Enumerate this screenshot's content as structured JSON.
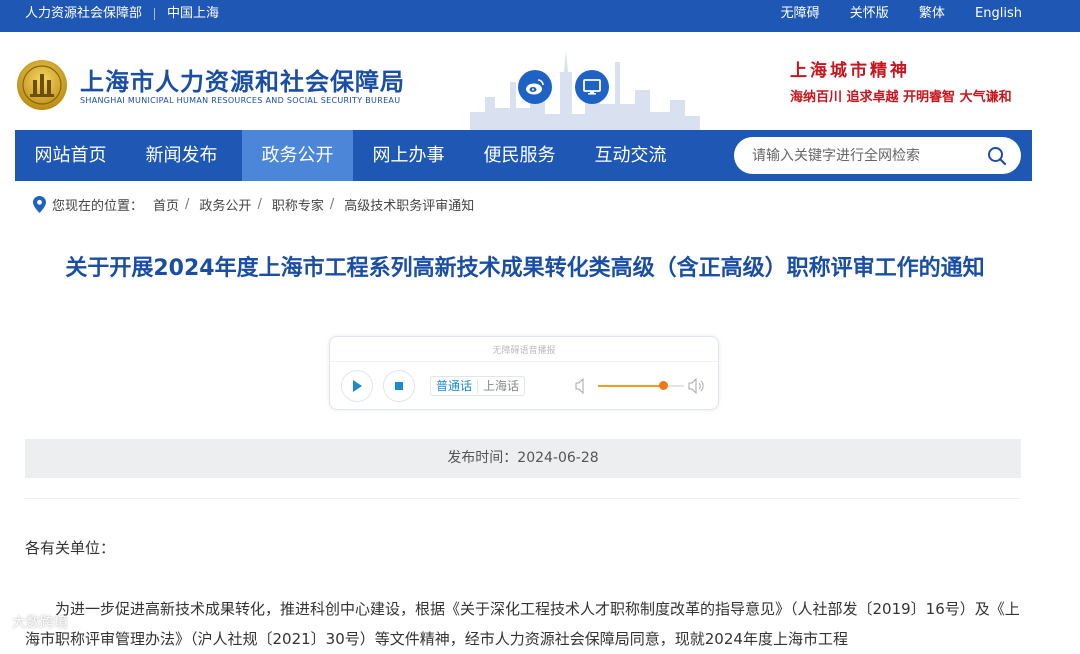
{
  "topbar": {
    "left_links": [
      "人力资源社会保障部",
      "中国上海"
    ],
    "right_links": [
      "无障碍",
      "关怀版",
      "繁体",
      "English"
    ]
  },
  "header": {
    "title": "上海市人力资源和社会保障局",
    "title_en": "SHANGHAI MUNICIPAL HUMAN RESOURCES AND SOCIAL SECURITY BUREAU",
    "icons": [
      "weibo-icon",
      "monitor-icon"
    ],
    "slogan_title": "上海城市精神",
    "slogan_text": "海纳百川 追求卓越 开明睿智 大气谦和"
  },
  "nav": {
    "items": [
      "网站首页",
      "新闻发布",
      "政务公开",
      "网上办事",
      "便民服务",
      "互动交流"
    ],
    "active": "政务公开",
    "search_placeholder": "请输入关键字进行全网检索"
  },
  "breadcrumb": {
    "label": "您现在的位置：",
    "items": [
      "首页",
      "政务公开",
      "职称专家",
      "高级技术职务评审通知"
    ]
  },
  "article": {
    "title": "关于开展2024年度上海市工程系列高新技术成果转化类高级（含正高级）职称评审工作的通知",
    "date": "发布时间：2024-06-28",
    "greeting": "各有关单位：",
    "paragraph": "为进一步促进高新技术成果转化，推进科创中心建设，根据《关于深化工程技术人才职称制度改革的指导意见》（人社部发〔2019〕16号）及《上海市职称评审管理办法》（沪人社规〔2021〕30号）等文件精神，经市人力资源社会保障局同意，现就2024年度上海市工程"
  },
  "player": {
    "title": "无障碍语音播报",
    "languages": [
      "普通话",
      "上海话"
    ],
    "selected_language": "普通话",
    "volume": 0.75
  },
  "watermark": "大数跨境",
  "colors": {
    "primary": "#1f57b5",
    "nav_active": "#4c86d8",
    "title_blue": "#1a4ea5",
    "slogan_red": "#c8151d",
    "volume_orange": "#f0781a"
  }
}
